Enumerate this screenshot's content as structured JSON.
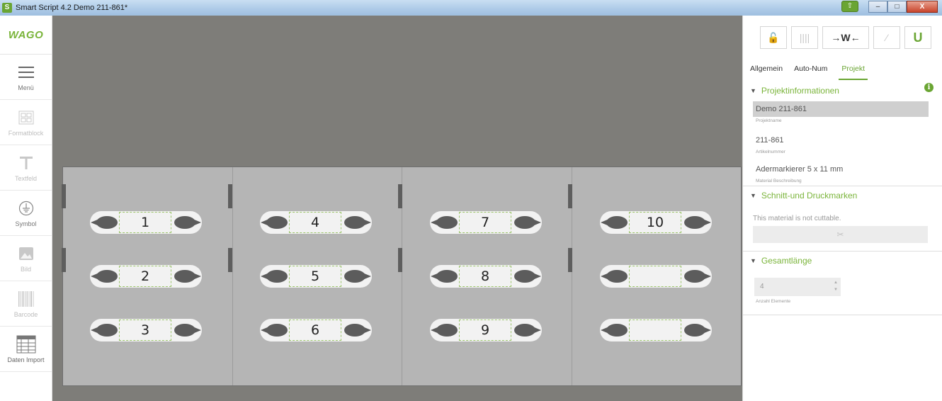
{
  "window": {
    "title": "Smart Script 4.2  Demo 211-861*",
    "app_icon": "S",
    "minimize": "–",
    "maximize": "□",
    "close": "X"
  },
  "sidebar": {
    "logo": "WAGO",
    "items": [
      {
        "label": "Menü",
        "icon": "hamburger-icon"
      },
      {
        "label": "Formatblock",
        "icon": "formatblock-icon"
      },
      {
        "label": "Textfeld",
        "icon": "text-icon"
      },
      {
        "label": "Symbol",
        "icon": "ground-symbol-icon"
      },
      {
        "label": "Bild",
        "icon": "image-icon"
      },
      {
        "label": "Barcode",
        "icon": "barcode-icon"
      },
      {
        "label": "Daten Import",
        "icon": "table-import-icon"
      }
    ]
  },
  "canvas": {
    "markers": [
      "1",
      "2",
      "3",
      "4",
      "5",
      "6",
      "7",
      "8",
      "9",
      "10",
      "",
      ""
    ]
  },
  "panel": {
    "toolbar": {
      "lock": "🔓",
      "columns": "||||",
      "wago_arrow": "→W←",
      "wand": "⁄",
      "magnet": "U"
    },
    "tabs": [
      "Allgemein",
      "Auto-Num",
      "Projekt"
    ],
    "project_info": {
      "heading": "Projektinformationen",
      "project_name": "Demo 211-861",
      "project_name_caption": "Projektname",
      "article_number": "211-861",
      "article_number_caption": "Artikelnummer",
      "material": "Adermarkierer 5 x 11 mm",
      "material_caption": "Material Beschreibung"
    },
    "cut_marks": {
      "heading": "Schnitt-und Druckmarken",
      "note": "This material is not cuttable.",
      "button_icon": "✂"
    },
    "total_length": {
      "heading": "Gesamtlänge",
      "elements": "4",
      "elements_caption": "Anzahl Elemente"
    }
  }
}
